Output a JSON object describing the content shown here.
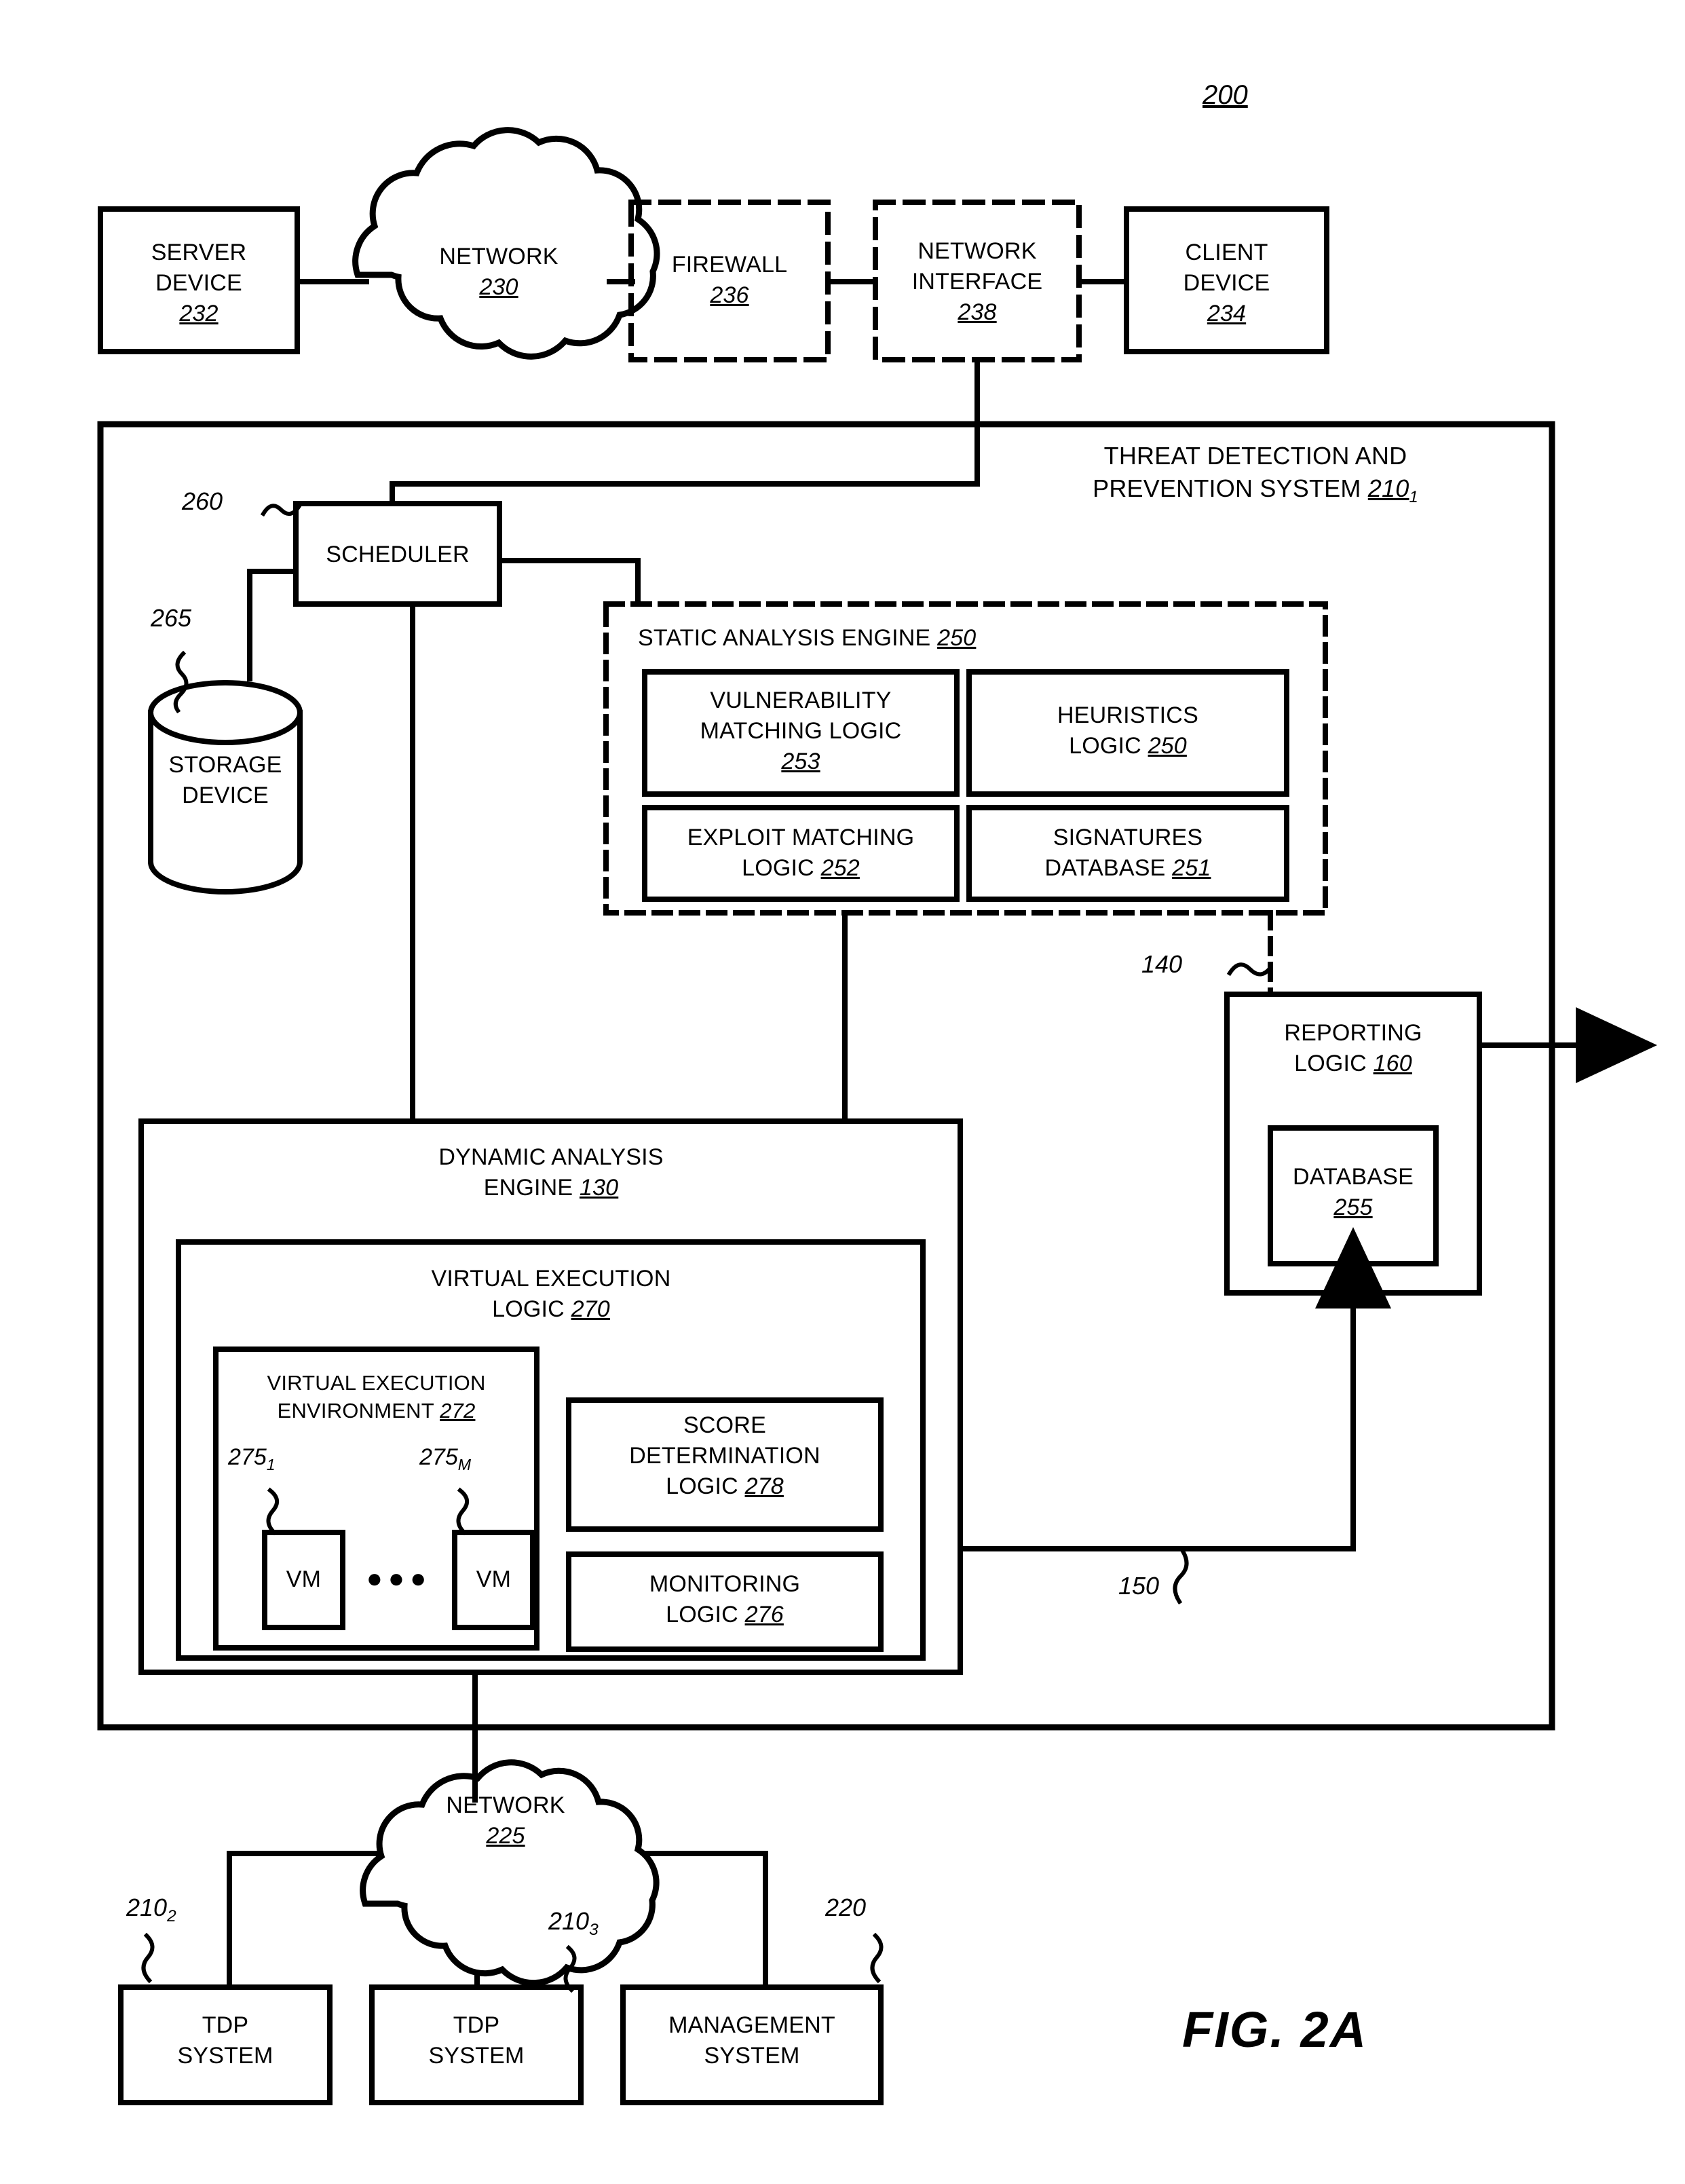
{
  "figure": {
    "number_label": "200",
    "caption": "FIG. 2A"
  },
  "top_row": {
    "server_device": {
      "line1": "SERVER",
      "line2": "DEVICE",
      "ref": "232"
    },
    "network_cloud": {
      "line1": "NETWORK",
      "ref": "230"
    },
    "firewall": {
      "line1": "FIREWALL",
      "ref": "236"
    },
    "network_interface": {
      "line1": "NETWORK",
      "line2": "INTERFACE",
      "ref": "238"
    },
    "client_device": {
      "line1": "CLIENT",
      "line2": "DEVICE",
      "ref": "234"
    }
  },
  "tdp_system": {
    "title_line1": "THREAT DETECTION AND",
    "title_line2": "PREVENTION SYSTEM",
    "title_ref": "210",
    "title_ref_sub": "1",
    "scheduler": {
      "label": "SCHEDULER",
      "callout": "260"
    },
    "storage_device": {
      "line1": "STORAGE",
      "line2": "DEVICE",
      "callout": "265"
    },
    "static_analysis_engine": {
      "title": "STATIC ANALYSIS ENGINE",
      "ref": "250",
      "boxes": [
        {
          "line1": "VULNERABILITY",
          "line2": "MATCHING LOGIC",
          "ref": "253"
        },
        {
          "line1": "HEURISTICS",
          "line2": "LOGIC",
          "ref": "250"
        },
        {
          "line1": "EXPLOIT MATCHING",
          "line2": "LOGIC",
          "ref": "252"
        },
        {
          "line1": "SIGNATURES",
          "line2": "DATABASE",
          "ref": "251"
        }
      ]
    },
    "reporting_logic": {
      "line1": "REPORTING",
      "line2": "LOGIC",
      "ref": "160",
      "callout": "140",
      "database": {
        "line1": "DATABASE",
        "ref": "255"
      }
    },
    "dynamic_analysis_engine": {
      "line1": "DYNAMIC ANALYSIS",
      "line2": "ENGINE",
      "ref": "130",
      "callout": "150",
      "virtual_execution_logic": {
        "line1": "VIRTUAL EXECUTION",
        "line2": "LOGIC",
        "ref": "270",
        "virtual_execution_environment": {
          "line1": "VIRTUAL EXECUTION",
          "line2": "ENVIRONMENT",
          "ref": "272",
          "vm_left": {
            "label": "VM",
            "callout": "275",
            "callout_sub": "1"
          },
          "vm_right": {
            "label": "VM",
            "callout": "275",
            "callout_sub": "M"
          },
          "ellipsis": "●●●"
        },
        "score_determination_logic": {
          "line1": "SCORE",
          "line2": "DETERMINATION",
          "line3": "LOGIC",
          "ref": "278"
        },
        "monitoring_logic": {
          "line1": "MONITORING",
          "line2": "LOGIC",
          "ref": "276"
        }
      }
    }
  },
  "bottom_row": {
    "network_cloud": {
      "line1": "NETWORK",
      "ref": "225"
    },
    "tdp_system_2": {
      "line1": "TDP",
      "line2": "SYSTEM",
      "callout": "210",
      "callout_sub": "2"
    },
    "tdp_system_3": {
      "line1": "TDP",
      "line2": "SYSTEM",
      "callout": "210",
      "callout_sub": "3"
    },
    "management_system": {
      "line1": "MANAGEMENT",
      "line2": "SYSTEM",
      "callout": "220"
    }
  },
  "style": {
    "stroke": "#000000",
    "background": "#ffffff"
  }
}
